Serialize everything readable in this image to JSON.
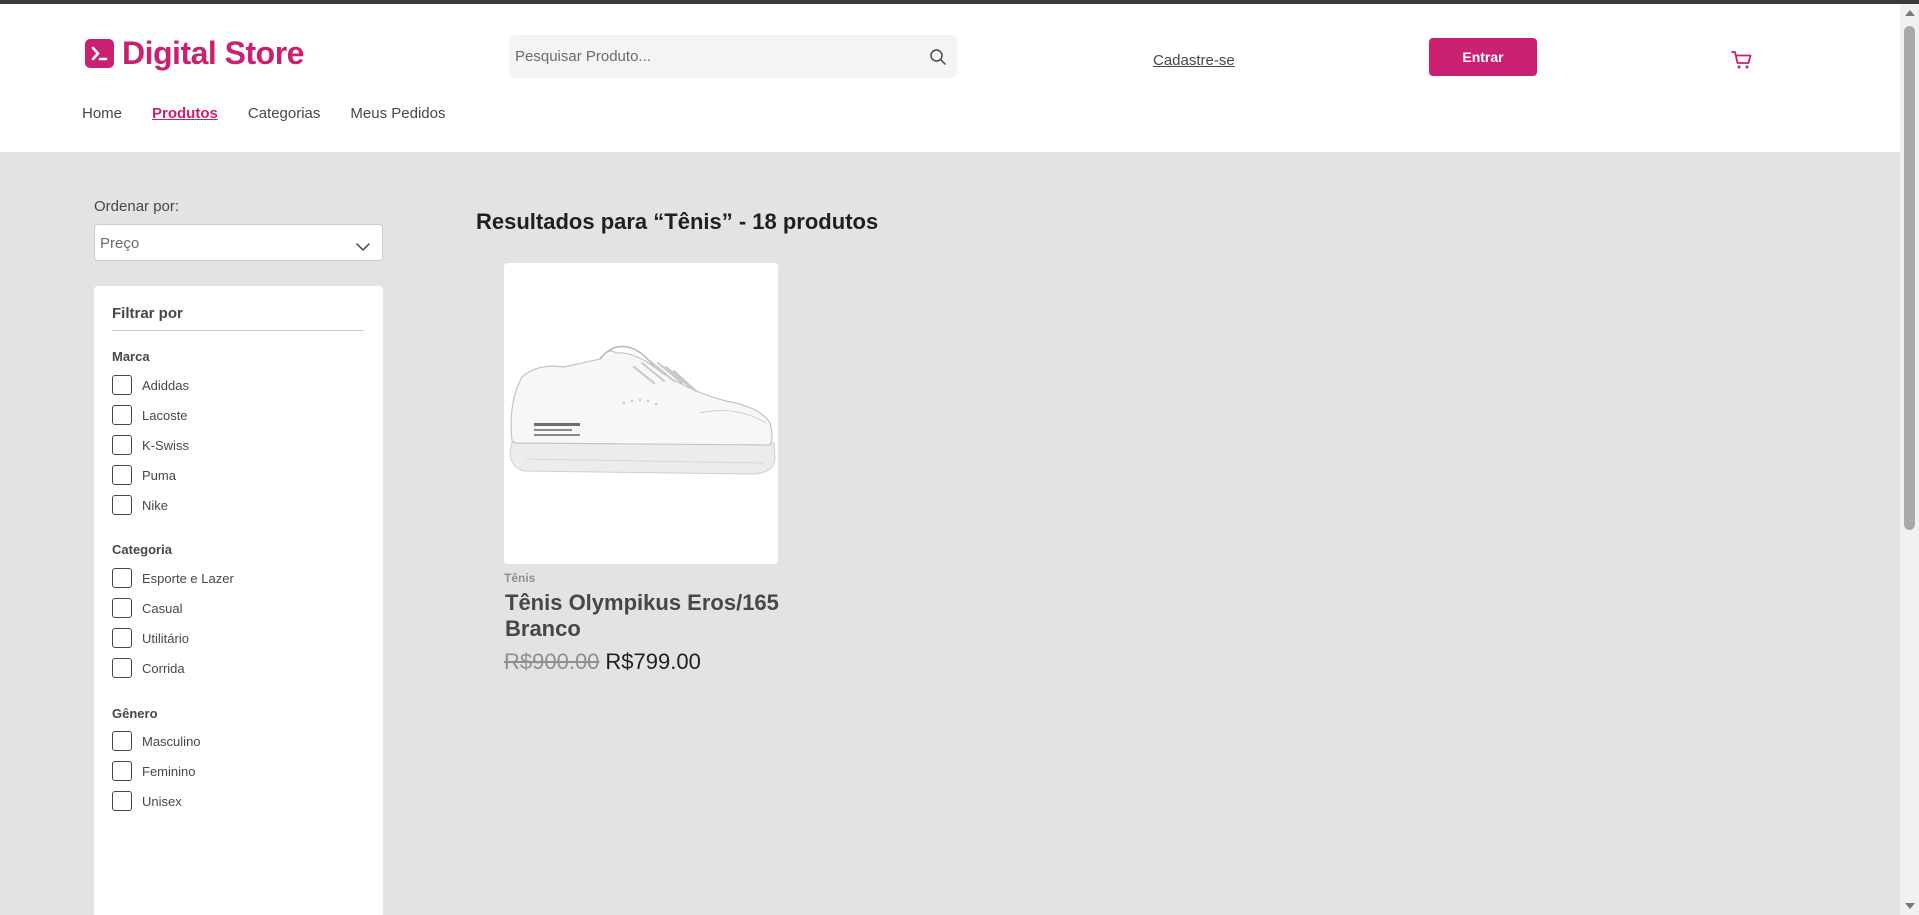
{
  "header": {
    "logo_text": "Digital Store",
    "search_placeholder": "Pesquisar Produto...",
    "signup_label": "Cadastre-se",
    "login_label": "Entrar"
  },
  "nav": [
    {
      "label": "Home",
      "active": false
    },
    {
      "label": "Produtos",
      "active": true
    },
    {
      "label": "Categorias",
      "active": false
    },
    {
      "label": "Meus Pedidos",
      "active": false
    }
  ],
  "sort": {
    "label": "Ordenar por:",
    "value": "Preço"
  },
  "filters": {
    "title": "Filtrar por",
    "groups": [
      {
        "title": "Marca",
        "options": [
          "Adiddas",
          "Lacoste",
          "K-Swiss",
          "Puma",
          "Nike"
        ]
      },
      {
        "title": "Categoria",
        "options": [
          "Esporte e Lazer",
          "Casual",
          "Utilitário",
          "Corrida"
        ]
      },
      {
        "title": "Gênero",
        "options": [
          "Masculino",
          "Feminino",
          "Unisex"
        ]
      }
    ]
  },
  "results": {
    "title": "Resultados para “Tênis” - 18 produtos"
  },
  "product": {
    "category": "Tênis",
    "name": "Tênis Olympikus Eros/165 Branco",
    "price_old": "R$900.00",
    "price_new": "R$799.00"
  },
  "colors": {
    "brand": "#c92071",
    "background": "#e3e3e3",
    "text": "#474747"
  },
  "icons": {
    "logo": "terminal-icon",
    "search": "search-icon",
    "cart": "cart-icon",
    "sort": "chevron-down-icon"
  }
}
